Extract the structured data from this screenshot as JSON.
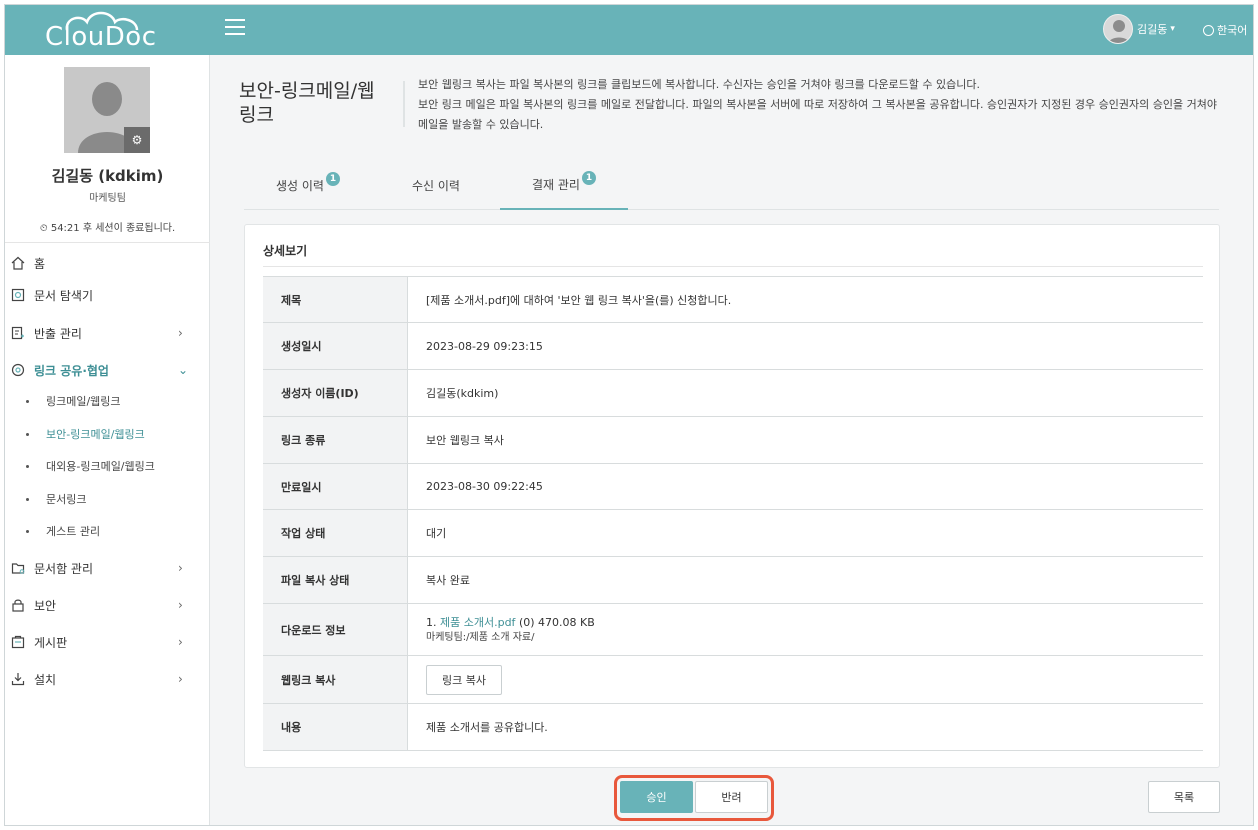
{
  "app": {
    "logo_text": "ClouDoc"
  },
  "header": {
    "user_name": "김길동",
    "user_caret": "▾",
    "language": "한국어"
  },
  "profile": {
    "name": "김길동 (kdkim)",
    "department": "마케팅팀",
    "session_text": "54:21 후 세션이 종료됩니다."
  },
  "sidebar": {
    "items": [
      {
        "label": "홈",
        "icon": "home-icon"
      },
      {
        "label": "문서 탐색기",
        "icon": "document-search-icon"
      },
      {
        "label": "반출 관리",
        "icon": "export-icon",
        "chevron": "›"
      },
      {
        "label": "링크 공유·협업",
        "icon": "link-share-icon",
        "chevron": "⌄"
      },
      {
        "label": "문서함 관리",
        "icon": "folder-icon",
        "chevron": "›"
      },
      {
        "label": "보안",
        "icon": "lock-icon",
        "chevron": "›"
      },
      {
        "label": "게시판",
        "icon": "board-icon",
        "chevron": "›"
      },
      {
        "label": "설치",
        "icon": "install-icon",
        "chevron": "›"
      }
    ],
    "sub_items": [
      {
        "label": "링크메일/웹링크"
      },
      {
        "label": "보안-링크메일/웹링크"
      },
      {
        "label": "대외용-링크메일/웹링크"
      },
      {
        "label": "문서링크"
      },
      {
        "label": "게스트 관리"
      }
    ]
  },
  "page": {
    "title": "보안-링크메일/웹링크",
    "description_1": "보안 웹링크 복사는 파일 복사본의 링크를 클립보드에 복사합니다. 수신자는 승인을 거쳐야 링크를 다운로드할 수 있습니다.",
    "description_2": "보안 링크 메일은 파일 복사본의 링크를 메일로 전달합니다. 파일의 복사본을 서버에 따로 저장하여 그 복사본을 공유합니다. 승인권자가 지정된 경우 승인권자의 승인을 거쳐야 메일을 발송할 수 있습니다."
  },
  "tabs": [
    {
      "label": "생성 이력",
      "badge": "1"
    },
    {
      "label": "수신 이력",
      "badge": ""
    },
    {
      "label": "결재 관리",
      "badge": "1"
    }
  ],
  "detail": {
    "section_title": "상세보기",
    "rows": [
      {
        "label": "제목",
        "value": "[제품 소개서.pdf]에 대하여 '보안 웹 링크 복사'을(를) 신청합니다."
      },
      {
        "label": "생성일시",
        "value": "2023-08-29 09:23:15"
      },
      {
        "label": "생성자 이름(ID)",
        "value": "김길동(kdkim)"
      },
      {
        "label": "링크 종류",
        "value": "보안 웹링크 복사"
      },
      {
        "label": "만료일시",
        "value": "2023-08-30 09:22:45"
      },
      {
        "label": "작업 상태",
        "value": "대기"
      },
      {
        "label": "파일 복사 상태",
        "value": "복사 완료"
      },
      {
        "label": "다운로드 정보",
        "value": ""
      },
      {
        "label": "웹링크 복사",
        "value": ""
      },
      {
        "label": "내용",
        "value": "제품 소개서를 공유합니다."
      }
    ],
    "download": {
      "index": "1.",
      "file_name": "제품 소개서.pdf",
      "count": "(0)",
      "size": "470.08 KB",
      "path": "마케팅팀:/제품 소개 자료/"
    },
    "copy_button_label": "링크 복사"
  },
  "actions": {
    "approve_label": "승인",
    "reject_label": "반려",
    "list_label": "목록"
  },
  "colors": {
    "brand": "#68b3b8",
    "accent_text": "#3e8f95",
    "highlight": "#e8583c"
  }
}
